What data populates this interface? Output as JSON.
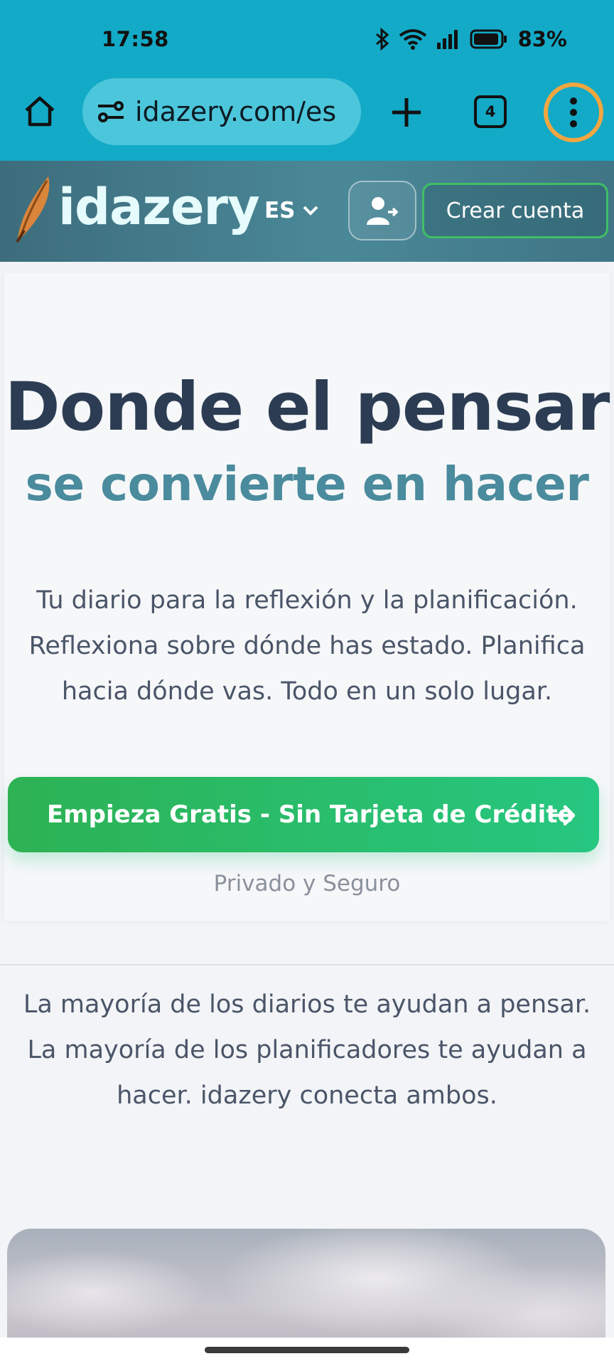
{
  "status": {
    "time": "17:58",
    "battery": "83%"
  },
  "browser": {
    "url": "idazery.com/es",
    "tab_count": "4"
  },
  "site": {
    "brand": "idazery",
    "language": "ES",
    "signup_label": "Crear cuenta"
  },
  "hero": {
    "title_line1": "Donde el pensar",
    "title_line2": "se convierte en hacer",
    "subtitle": "Tu diario para la reflexión y la planificación. Reflexiona sobre dónde has estado. Planifica hacia dónde vas. Todo en un solo lugar.",
    "cta_label": "Empieza Gratis - Sin Tarjeta de Crédito",
    "privacy_note": "Privado y Seguro"
  },
  "intro": {
    "text": "La mayoría de los diarios te ayudan a pensar. La mayoría de los planificadores te ayudan a hacer. idazery conecta ambos."
  },
  "colors": {
    "browser_bar": "#13aac7",
    "title_dark": "#2c3d53",
    "title_accent": "#4a8b9d",
    "cta_start": "#2db254",
    "cta_end": "#26c781",
    "highlight_ring": "#f2a640"
  }
}
